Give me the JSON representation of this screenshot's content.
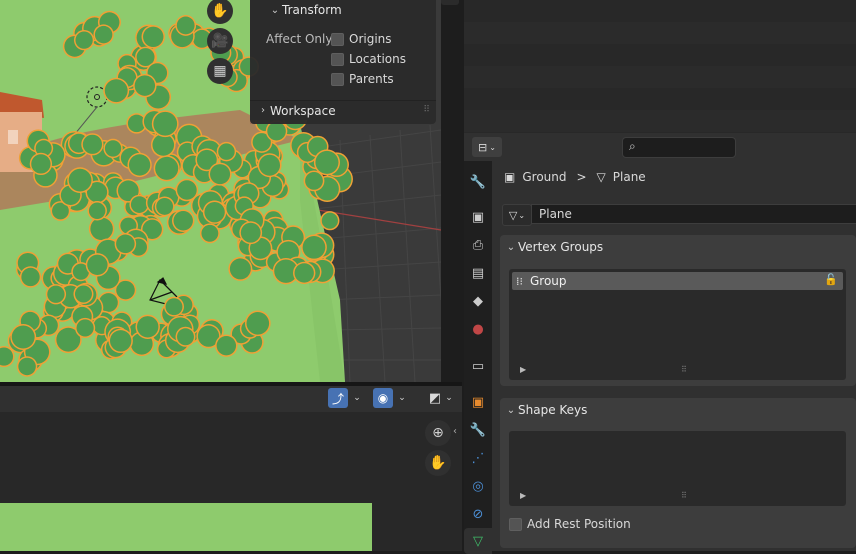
{
  "redo_panel": {
    "title": "Transform",
    "affect_only_label": "Affect Only",
    "options": [
      "Origins",
      "Locations",
      "Parents"
    ],
    "workspace_label": "Workspace"
  },
  "viewport_nav": {
    "pan_icon": "hand-icon",
    "camera_icon": "camera-icon",
    "ortho_icon": "grid-icon",
    "zoom_icon": "zoom-icon"
  },
  "properties": {
    "breadcrumb_object": "Ground",
    "breadcrumb_sep": ">",
    "breadcrumb_mesh": "Plane",
    "mesh_name": "Plane",
    "vertex_groups_title": "Vertex Groups",
    "vertex_group_item": "Group",
    "shape_keys_title": "Shape Keys",
    "add_rest_position_label": "Add Rest Position"
  },
  "colors": {
    "accent_blue": "#4772b3",
    "ground_green": "#8ecb6d",
    "tree_green": "#4f9d4f",
    "selection_orange": "#f0a035"
  }
}
